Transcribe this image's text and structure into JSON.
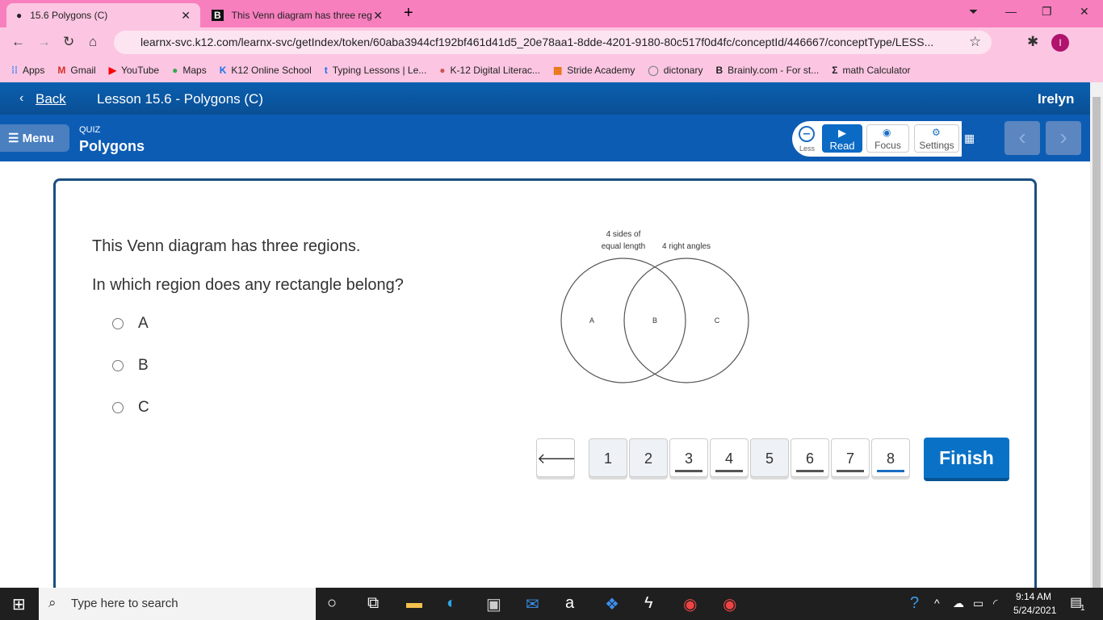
{
  "browser": {
    "tabs": [
      {
        "title": "15.6 Polygons (C)"
      },
      {
        "title": "This Venn diagram has three reg"
      }
    ],
    "url": "learnx-svc.k12.com/learnx-svc/getIndex/token/60aba3944cf192bf461d41d5_20e78aa1-8dde-4201-9180-80c517f0d4fc/conceptId/446667/conceptType/LESS...",
    "bookmarks": [
      "Apps",
      "Gmail",
      "YouTube",
      "Maps",
      "K12 Online School",
      "Typing Lessons | Le...",
      "K-12 Digital Literac...",
      "Stride Academy",
      "dictonary",
      "Brainly.com - For st...",
      "math Calculator"
    ],
    "profile_initial": "I"
  },
  "header": {
    "back": "Back",
    "lesson": "Lesson 15.6 - Polygons (C)",
    "user": "Irelyn",
    "menu": "Menu",
    "kind": "QUIZ",
    "title": "Polygons",
    "tools": {
      "less": "Less",
      "read": "Read",
      "focus": "Focus",
      "settings": "Settings"
    }
  },
  "question": {
    "intro": "This Venn diagram has three regions.",
    "prompt": "In which region does any rectangle belong?",
    "options": [
      "A",
      "B",
      "C"
    ]
  },
  "venn": {
    "left_label_1": "4 sides of",
    "left_label_2": "equal length",
    "right_label": "4 right angles",
    "regions": [
      "A",
      "B",
      "C"
    ]
  },
  "pager": {
    "pages": [
      "1",
      "2",
      "3",
      "4",
      "5",
      "6",
      "7",
      "8"
    ],
    "current": "8",
    "finish": "Finish"
  },
  "taskbar": {
    "search": "Type here to search",
    "time": "9:14 AM",
    "date": "5/24/2021",
    "notifications": "1"
  }
}
